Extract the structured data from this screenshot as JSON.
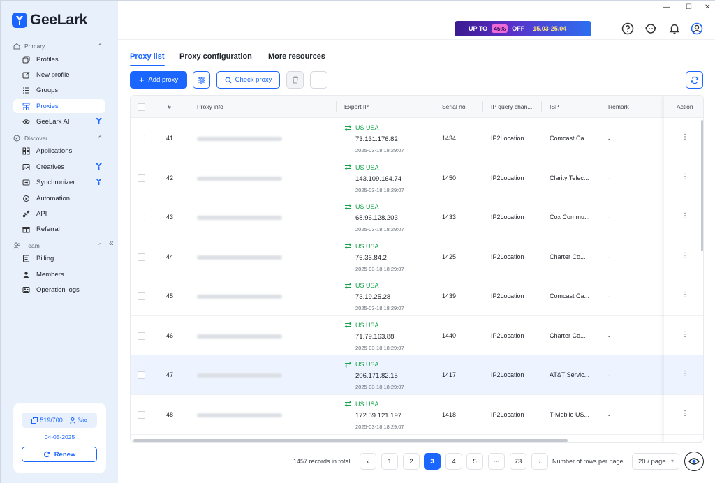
{
  "app": {
    "brand": "GeeLark"
  },
  "window": {
    "minimize": "—",
    "maximize": "☐",
    "close": "✕"
  },
  "promo": {
    "up_to": "UP TO",
    "percent": "45%",
    "off": "OFF",
    "dates": "15.03-25.04"
  },
  "sidebar": {
    "sections": [
      {
        "label": "Primary"
      },
      {
        "label": "Discover"
      },
      {
        "label": "Team"
      }
    ],
    "items": [
      {
        "label": "Profiles",
        "icon": "profiles-icon"
      },
      {
        "label": "New profile",
        "icon": "edit-icon"
      },
      {
        "label": "Groups",
        "icon": "list-icon"
      },
      {
        "label": "Proxies",
        "icon": "proxies-icon",
        "active": true
      },
      {
        "label": "GeeLark AI",
        "icon": "ai-icon"
      },
      {
        "label": "Applications",
        "icon": "grid-icon"
      },
      {
        "label": "Creatives",
        "icon": "image-icon"
      },
      {
        "label": "Synchronizer",
        "icon": "sync-icon"
      },
      {
        "label": "Automation",
        "icon": "automation-icon"
      },
      {
        "label": "API",
        "icon": "api-icon"
      },
      {
        "label": "Referral",
        "icon": "gift-icon"
      },
      {
        "label": "Billing",
        "icon": "billing-icon"
      },
      {
        "label": "Members",
        "icon": "user-icon"
      },
      {
        "label": "Operation logs",
        "icon": "logs-icon"
      }
    ],
    "collapse": "«",
    "quota": {
      "profiles": "519/700",
      "members": "3/∞"
    },
    "expire_date": "04-05-2025",
    "renew_label": "Renew"
  },
  "tabs": [
    {
      "label": "Proxy list",
      "active": true
    },
    {
      "label": "Proxy configuration"
    },
    {
      "label": "More resources"
    }
  ],
  "toolbar": {
    "add_proxy": "Add proxy",
    "check_proxy": "Check proxy",
    "more": "···"
  },
  "table": {
    "columns": [
      "#",
      "Proxy info",
      "Export IP",
      "Serial no.",
      "IP query chan...",
      "ISP",
      "Remark",
      "Action"
    ],
    "rows": [
      {
        "num": "41",
        "country": "US USA",
        "ip": "73.131.176.82",
        "time": "2025-03-18 18:29:07",
        "serial": "1434",
        "channel": "IP2Location",
        "isp": "Comcast Ca...",
        "remark": "-"
      },
      {
        "num": "42",
        "country": "US USA",
        "ip": "143.109.164.74",
        "time": "2025-03-18 18:29:07",
        "serial": "1450",
        "channel": "IP2Location",
        "isp": "Clarity Telec...",
        "remark": "-"
      },
      {
        "num": "43",
        "country": "US USA",
        "ip": "68.96.128.203",
        "time": "2025-03-18 18:29:07",
        "serial": "1433",
        "channel": "IP2Location",
        "isp": "Cox Commu...",
        "remark": "-"
      },
      {
        "num": "44",
        "country": "US USA",
        "ip": "76.36.84.2",
        "time": "2025-03-18 18:29:07",
        "serial": "1425",
        "channel": "IP2Location",
        "isp": "Charter Co...",
        "remark": "-"
      },
      {
        "num": "45",
        "country": "US USA",
        "ip": "73.19.25.28",
        "time": "2025-03-18 18:29:07",
        "serial": "1439",
        "channel": "IP2Location",
        "isp": "Comcast Ca...",
        "remark": "-"
      },
      {
        "num": "46",
        "country": "US USA",
        "ip": "71.79.163.88",
        "time": "2025-03-18 18:29:07",
        "serial": "1440",
        "channel": "IP2Location",
        "isp": "Charter Co...",
        "remark": "-"
      },
      {
        "num": "47",
        "country": "US USA",
        "ip": "206.171.82.15",
        "time": "2025-03-18 18:29:07",
        "serial": "1417",
        "channel": "IP2Location",
        "isp": "AT&T Servic...",
        "remark": "-",
        "highlighted": true
      },
      {
        "num": "48",
        "country": "US USA",
        "ip": "172.59.121.197",
        "time": "2025-03-18 18:29:07",
        "serial": "1418",
        "channel": "IP2Location",
        "isp": "T-Mobile US...",
        "remark": "-"
      }
    ]
  },
  "pagination": {
    "total": "1457 records in total",
    "pages": [
      "1",
      "2",
      "3",
      "4",
      "5",
      "···",
      "73"
    ],
    "current": "3",
    "prev": "‹",
    "next": "›",
    "rows_label": "Number of rows per page",
    "page_size": "20 / page"
  },
  "colors": {
    "accent": "#1a66ff",
    "success": "#16a34a",
    "sidebar_bg": "#e8f0fc"
  }
}
